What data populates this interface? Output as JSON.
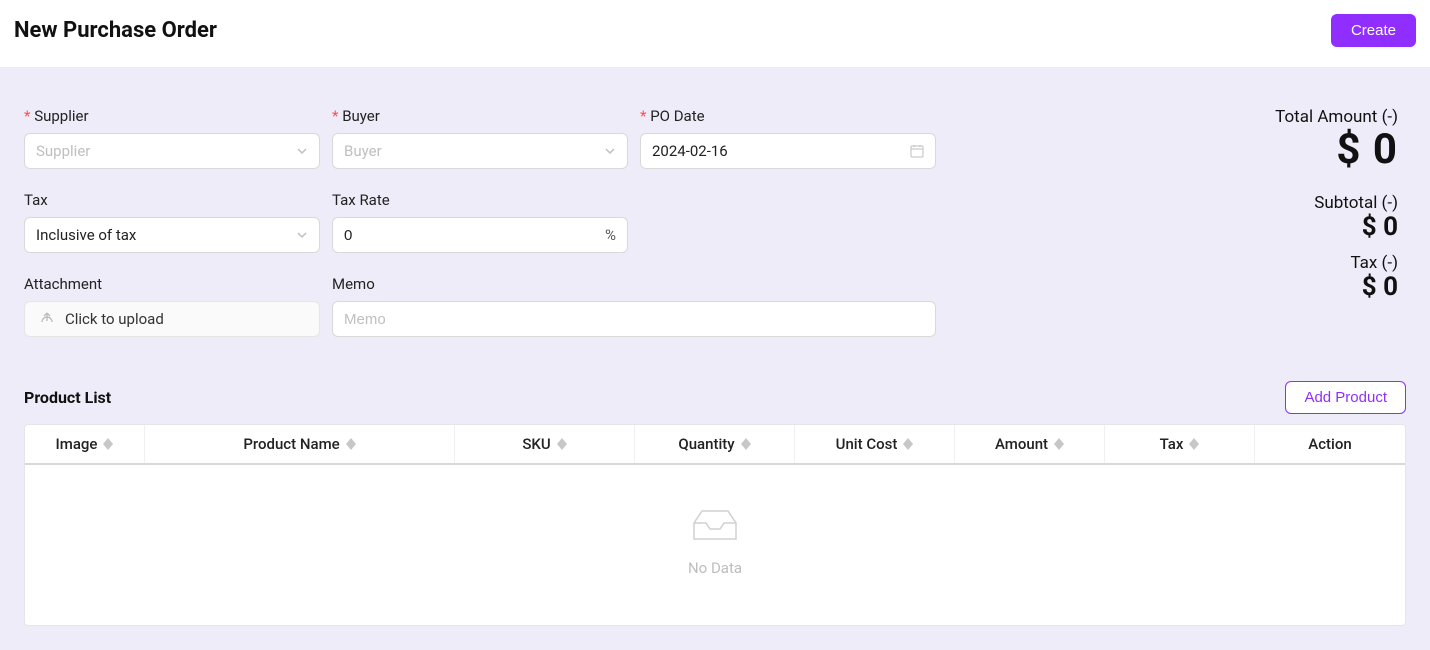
{
  "header": {
    "title": "New Purchase Order",
    "create_label": "Create"
  },
  "form": {
    "supplier": {
      "label": "Supplier",
      "placeholder": "Supplier",
      "value": ""
    },
    "buyer": {
      "label": "Buyer",
      "placeholder": "Buyer",
      "value": ""
    },
    "po_date": {
      "label": "PO Date",
      "value": "2024-02-16"
    },
    "tax": {
      "label": "Tax",
      "value": "Inclusive of tax"
    },
    "tax_rate": {
      "label": "Tax Rate",
      "value": "0",
      "suffix": "%"
    },
    "attachment": {
      "label": "Attachment",
      "upload_text": "Click to upload"
    },
    "memo": {
      "label": "Memo",
      "placeholder": "Memo",
      "value": ""
    }
  },
  "summary": {
    "total_label": "Total Amount (-)",
    "total_value": "$ 0",
    "subtotal_label": "Subtotal (-)",
    "subtotal_value": "$ 0",
    "tax_label": "Tax (-)",
    "tax_value": "$ 0"
  },
  "product_list": {
    "title": "Product List",
    "add_label": "Add Product",
    "columns": {
      "image": "Image",
      "name": "Product Name",
      "sku": "SKU",
      "qty": "Quantity",
      "cost": "Unit Cost",
      "amount": "Amount",
      "tax": "Tax",
      "action": "Action"
    },
    "empty_text": "No Data",
    "rows": []
  }
}
